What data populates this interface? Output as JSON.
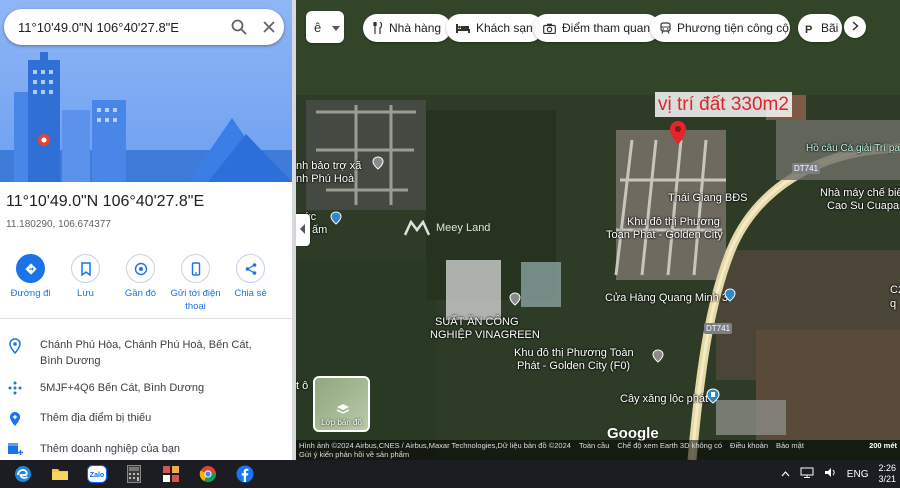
{
  "search": {
    "query": "11°10'49.0\"N 106°40'27.8\"E"
  },
  "place": {
    "title": "11°10'49.0\"N 106°40'27.8\"E",
    "decimal": "11.180290, 106.674377"
  },
  "actions": [
    {
      "label": "Đường đi",
      "icon": "directions-icon"
    },
    {
      "label": "Lưu",
      "icon": "bookmark-icon"
    },
    {
      "label": "Gần đó",
      "icon": "nearby-icon"
    },
    {
      "label": "Gửi tới điện thoại",
      "icon": "phone-icon"
    },
    {
      "label": "Chia sẻ",
      "icon": "share-icon"
    }
  ],
  "info": [
    {
      "icon": "location-pin-icon",
      "text": "Chánh Phú Hòa, Chánh Phú Hoà, Bến Cát, Bình Dương"
    },
    {
      "icon": "plus-code-icon",
      "text": "5MJF+4Q6 Bến Cát, Bình Dương"
    },
    {
      "icon": "add-place-icon",
      "text": "Thêm địa điểm bị thiếu"
    },
    {
      "icon": "add-business-icon",
      "text": "Thêm doanh nghiệp của bạn"
    }
  ],
  "map": {
    "lang_chip": "ê",
    "categories": [
      {
        "label": "Nhà hàng",
        "icon": "restaurant-icon"
      },
      {
        "label": "Khách sạn",
        "icon": "hotel-icon"
      },
      {
        "label": "Điểm tham quan",
        "icon": "camera-icon"
      },
      {
        "label": "Phương tiện công cộ...",
        "icon": "transit-icon"
      },
      {
        "label": "Bãi",
        "icon": "parking-icon"
      }
    ],
    "red_label": "vị trí đất 330m2",
    "watermark": "Meey Land",
    "labels": {
      "bao_tro": "nh bảo trợ xã",
      "chanh_phu": "nh Phú Hoà",
      "huoc": "ước",
      "am": "ấm",
      "thai_giang": "Thái Giang BĐS",
      "khu_do_thi_1": "Khu đô thị Phương",
      "khu_do_thi_2": "Toàn Phát - Golden City",
      "cua_hang": "Cửa Hàng Quang Minh 3",
      "suat_an_1": "SUẤT ĂN CÔNG",
      "suat_an_2": "NGHIỆP VINAGREEN",
      "khu_f0_1": "Khu đô thị Phương Toàn",
      "khu_f0_2": "Phát - Golden City (F0)",
      "cay_xang": "Cây xăng lộc phát",
      "ho_cau": "Hồ câu Cá giải Trí pa",
      "nha_may_1": "Nhà máy chế biế",
      "nha_may_2": "Cao Su Cuaparis",
      "dt741_a": "DT741",
      "dt741_b": "DT741",
      "c2": "C2",
      "t_o": "t ô",
      "q": "q"
    },
    "layer_button": "Lớp bản đồ",
    "google": "Google",
    "attribution": {
      "imagery": "Hình ảnh ©2024 Airbus,CNES / Airbus,Maxar Technologies,Dữ liệu bản đồ ©2024",
      "global": "Toàn cầu",
      "earth": "Chế độ xem Earth 3D không có",
      "terms": "Điều khoản",
      "privacy": "Bảo mật",
      "feedback": "Gửi ý kiến phản hồi về sản phẩm",
      "scale": "200 mét"
    }
  },
  "taskbar": {
    "apps": [
      "edge-icon",
      "file-explorer-icon",
      "zalo-icon",
      "calculator-icon",
      "app-icon",
      "chrome-icon",
      "facebook-icon"
    ],
    "zalo_label": "Zalo",
    "lang": "ENG",
    "time": "2:26",
    "date": "3/21"
  }
}
